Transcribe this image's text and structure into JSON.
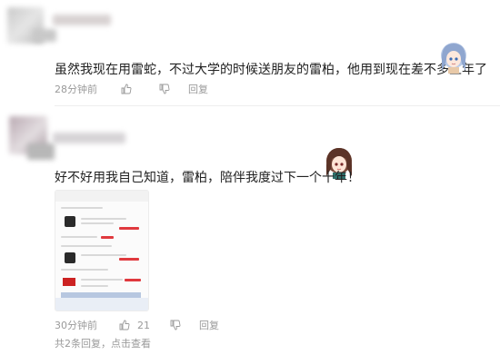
{
  "comments": [
    {
      "text": "虽然我现在用雷蛇，不过大学的时候送朋友的雷柏，他用到现在差不多五年了",
      "time": "28分钟前",
      "like_count": "",
      "reply_label": "回复",
      "sticker": "anime-girl-blue-hair"
    },
    {
      "text": "好不好用我自己知道，雷柏，陪伴我度过下一个十年！",
      "time": "30分钟前",
      "like_count": "21",
      "reply_label": "回复",
      "sticker": "anime-girl-brown-hair",
      "footer": "共2条回复，点击查看"
    }
  ],
  "icons": {
    "like": "thumbs-up-icon",
    "dislike": "thumbs-down-icon"
  },
  "colors": {
    "text": "#222222",
    "meta": "#9a9a9a",
    "accent": "#e0393e"
  }
}
